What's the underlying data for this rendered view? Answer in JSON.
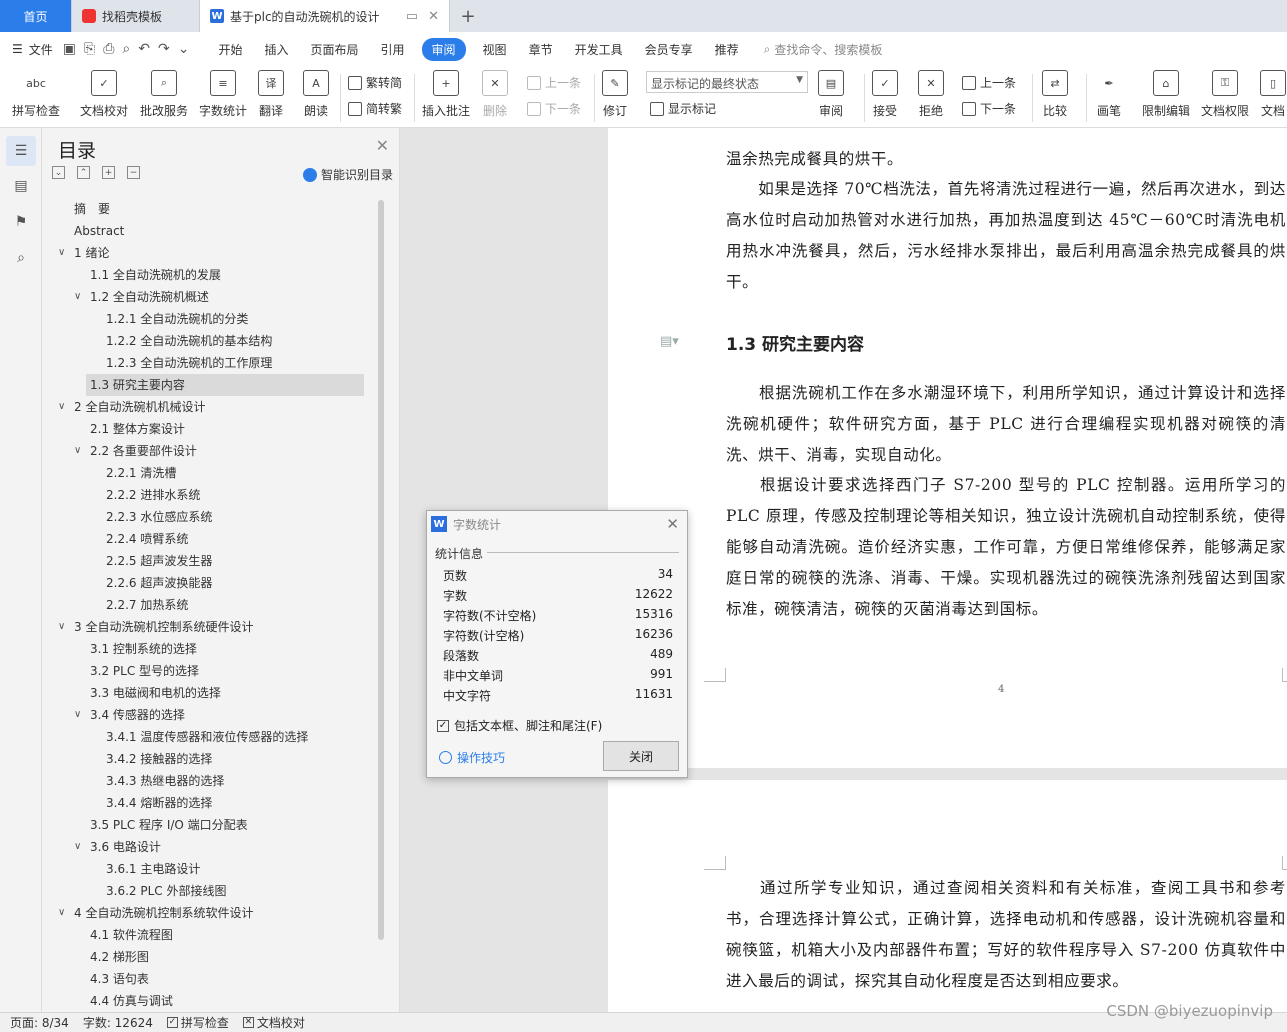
{
  "tabs": {
    "home": "首页",
    "template": "找稻壳模板",
    "doc": "基于plc的自动洗碗机的设计",
    "add": "+"
  },
  "menu": {
    "file": "文件",
    "items": [
      "开始",
      "插入",
      "页面布局",
      "引用",
      "审阅",
      "视图",
      "章节",
      "开发工具",
      "会员专享",
      "推荐"
    ],
    "active": "审阅",
    "search": "查找命令、搜索模板"
  },
  "ribbon": {
    "spell": "拼写检查",
    "proof": "文档校对",
    "batch": "批改服务",
    "wordcount": "字数统计",
    "translate": "翻译",
    "read": "朗读",
    "trad": "繁转简",
    "simp": "简转繁",
    "insert_comment": "插入批注",
    "delete": "删除",
    "prev": "上一条",
    "next": "下一条",
    "revise": "修订",
    "markup_select": "显示标记的最终状态",
    "show_markup": "显示标记",
    "review": "审阅",
    "accept": "接受",
    "reject": "拒绝",
    "prev2": "上一条",
    "next2": "下一条",
    "compare": "比较",
    "pen": "画笔",
    "restrict": "限制编辑",
    "perm": "文档权限",
    "more": "文档"
  },
  "toc": {
    "title": "目录",
    "smart": "智能识别目录",
    "items": [
      {
        "label": "摘　要",
        "level": 0,
        "chev": ""
      },
      {
        "label": "Abstract",
        "level": 0,
        "chev": ""
      },
      {
        "label": "1 绪论",
        "level": 0,
        "chev": "∨"
      },
      {
        "label": "1.1 全自动洗碗机的发展",
        "level": 1,
        "chev": ""
      },
      {
        "label": "1.2 全自动洗碗机概述",
        "level": 1,
        "chev": "∨"
      },
      {
        "label": "1.2.1  全自动洗碗机的分类",
        "level": 2,
        "chev": ""
      },
      {
        "label": "1.2.2  全自动洗碗机的基本结构",
        "level": 2,
        "chev": ""
      },
      {
        "label": "1.2.3  全自动洗碗机的工作原理",
        "level": 2,
        "chev": ""
      },
      {
        "label": "1.3 研究主要内容",
        "level": 1,
        "chev": "",
        "selected": true
      },
      {
        "label": "2  全自动洗碗机机械设计",
        "level": 0,
        "chev": "∨"
      },
      {
        "label": "2.1  整体方案设计",
        "level": 1,
        "chev": ""
      },
      {
        "label": "2.2  各重要部件设计",
        "level": 1,
        "chev": "∨"
      },
      {
        "label": "2.2.1 清洗槽",
        "level": 2,
        "chev": ""
      },
      {
        "label": "2.2.2 进排水系统",
        "level": 2,
        "chev": ""
      },
      {
        "label": "2.2.3 水位感应系统",
        "level": 2,
        "chev": ""
      },
      {
        "label": "2.2.4  喷臂系统",
        "level": 2,
        "chev": ""
      },
      {
        "label": "2.2.5 超声波发生器",
        "level": 2,
        "chev": ""
      },
      {
        "label": "2.2.6 超声波换能器",
        "level": 2,
        "chev": ""
      },
      {
        "label": "2.2.7  加热系统",
        "level": 2,
        "chev": ""
      },
      {
        "label": "3 全自动洗碗机控制系统硬件设计",
        "level": 0,
        "chev": "∨"
      },
      {
        "label": "3.1 控制系统的选择",
        "level": 1,
        "chev": ""
      },
      {
        "label": "3.2 PLC 型号的选择",
        "level": 1,
        "chev": ""
      },
      {
        "label": "3.3 电磁阀和电机的选择",
        "level": 1,
        "chev": ""
      },
      {
        "label": "3.4  传感器的选择",
        "level": 1,
        "chev": "∨"
      },
      {
        "label": "3.4.1 温度传感器和液位传感器的选择",
        "level": 2,
        "chev": ""
      },
      {
        "label": "3.4.2 接触器的选择",
        "level": 2,
        "chev": ""
      },
      {
        "label": "3.4.3 热继电器的选择",
        "level": 2,
        "chev": ""
      },
      {
        "label": "3.4.4 熔断器的选择",
        "level": 2,
        "chev": ""
      },
      {
        "label": "3.5 PLC 程序 I/O 端口分配表",
        "level": 1,
        "chev": ""
      },
      {
        "label": "3.6 电路设计",
        "level": 1,
        "chev": "∨"
      },
      {
        "label": "3.6.1 主电路设计",
        "level": 2,
        "chev": ""
      },
      {
        "label": "3.6.2 PLC 外部接线图",
        "level": 2,
        "chev": ""
      },
      {
        "label": "4 全自动洗碗机控制系统软件设计",
        "level": 0,
        "chev": "∨"
      },
      {
        "label": "4.1 软件流程图",
        "level": 1,
        "chev": ""
      },
      {
        "label": "4.2 梯形图",
        "level": 1,
        "chev": ""
      },
      {
        "label": "4.3 语句表",
        "level": 1,
        "chev": ""
      },
      {
        "label": "4.4 仿真与调试",
        "level": 1,
        "chev": ""
      }
    ]
  },
  "document": {
    "p0": "温余热完成餐具的烘干。",
    "p1": "　　如果是选择 70℃档洗法，首先将清洗过程进行一遍，然后再次进水，到达高水位时启动加热管对水进行加热，再加热温度到达 45℃－60℃时清洗电机用热水冲洗餐具，然后，污水经排水泵排出，最后利用高温余热完成餐具的烘干。",
    "heading": "1.3 研究主要内容",
    "p2": "　　根据洗碗机工作在多水潮湿环境下，利用所学知识，通过计算设计和选择洗碗机硬件；软件研究方面，基于 PLC 进行合理编程实现机器对碗筷的清洗、烘干、消毒，实现自动化。",
    "p3": "　　根据设计要求选择西门子 S7-200 型号的 PLC 控制器。运用所学习的 PLC 原理，传感及控制理论等相关知识，独立设计洗碗机自动控制系统，使得能够自动清洗碗。造价经济实惠，工作可靠，方便日常维修保养，能够满足家庭日常的碗筷的洗涤、消毒、干燥。实现机器洗过的碗筷洗涤剂残留达到国家标准，碗筷清洁，碗筷的灭菌消毒达到国标。",
    "page_number": "4",
    "p4": "　　通过所学专业知识，通过查阅相关资料和有关标准，查阅工具书和参考书，合理选择计算公式，正确计算，选择电动机和传感器，设计洗碗机容量和碗筷篮，机箱大小及内部器件布置；写好的软件程序导入 S7-200 仿真软件中进入最后的调试，探究其自动化程度是否达到相应要求。"
  },
  "dialog": {
    "title": "字数统计",
    "section": "统计信息",
    "rows": [
      {
        "label": "页数",
        "value": "34"
      },
      {
        "label": "字数",
        "value": "12622"
      },
      {
        "label": "字符数(不计空格)",
        "value": "15316"
      },
      {
        "label": "字符数(计空格)",
        "value": "16236"
      },
      {
        "label": "段落数",
        "value": "489"
      },
      {
        "label": "非中文单词",
        "value": "991"
      },
      {
        "label": "中文字符",
        "value": "11631"
      }
    ],
    "include": "包括文本框、脚注和尾注(F)",
    "tips": "操作技巧",
    "close": "关闭"
  },
  "status": {
    "page": "页面: 8/34",
    "words": "字数: 12624",
    "spell": "拼写检查",
    "proof": "文档校对"
  },
  "watermark": "CSDN @biyezuopinvip"
}
